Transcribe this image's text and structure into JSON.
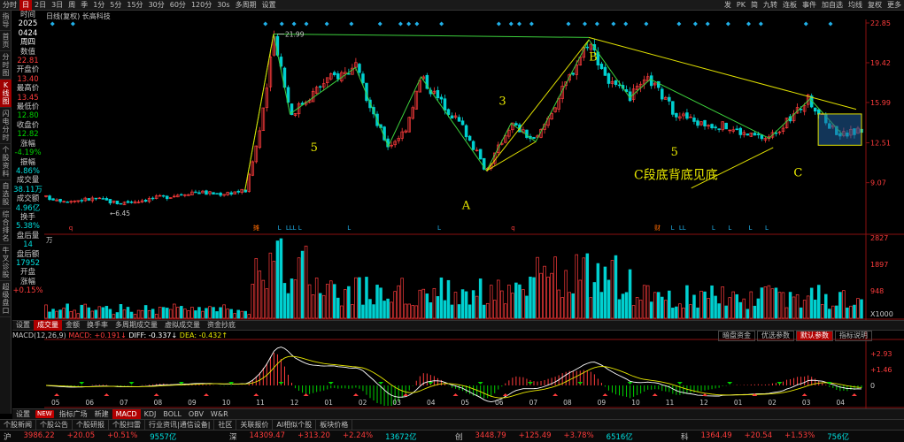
{
  "topbar": {
    "items": [
      "分时",
      "日",
      "2日",
      "3日",
      "周",
      "季",
      "1分",
      "5分",
      "15分",
      "30分",
      "60分",
      "120分",
      "30s",
      "多周期",
      "设置"
    ],
    "active_index": 1,
    "right_items": [
      "发",
      "PK",
      "简",
      "九转",
      "连板",
      "事件",
      "加自选",
      "均线",
      "复权",
      "更多"
    ]
  },
  "leftnav": [
    "指导",
    "首页",
    "分时图",
    "K线图",
    "闪电分时",
    "个股资料",
    "自选股",
    "综合排名",
    "牛叉诊股",
    "超级盘口"
  ],
  "leftnav_active": 3,
  "chart_title": "日线(复权) 长高科技",
  "info": [
    {
      "label": "时间",
      "value": "2025",
      "cls": "wht"
    },
    {
      "label": "",
      "value": "0424",
      "cls": "wht"
    },
    {
      "label": "",
      "value": "周四",
      "cls": "wht"
    },
    {
      "label": "数值",
      "value": "22.81",
      "cls": "red"
    },
    {
      "label": "开盘价",
      "value": "13.40",
      "cls": "red"
    },
    {
      "label": "最高价",
      "value": "13.45",
      "cls": "red"
    },
    {
      "label": "最低价",
      "value": "12.80",
      "cls": "grn"
    },
    {
      "label": "收盘价",
      "value": "12.82",
      "cls": "grn"
    },
    {
      "label": "涨幅",
      "value": "-4.19%",
      "cls": "grn"
    },
    {
      "label": "振幅",
      "value": "4.86%",
      "cls": "cyn"
    },
    {
      "label": "成交量",
      "value": "38.11万",
      "cls": "cyn"
    },
    {
      "label": "成交额",
      "value": "4.96亿",
      "cls": "cyn"
    },
    {
      "label": "换手",
      "value": "5.38%",
      "cls": "cyn"
    },
    {
      "label": "盘后量",
      "value": "14",
      "cls": "cyn"
    },
    {
      "label": "盘后额",
      "value": "17952",
      "cls": "cyn"
    },
    {
      "label": "开盘",
      "value": "",
      "cls": "cyn"
    },
    {
      "label": "涨幅",
      "value": "+0.15%",
      "cls": "red"
    }
  ],
  "price_axis": [
    "22.85",
    "19.42",
    "15.99",
    "12.51",
    "9.07"
  ],
  "price_marks": {
    "high": "21.99",
    "low": "6.45"
  },
  "annotations": {
    "wave5_left": "5",
    "wave3": "3",
    "labelA": "A",
    "labelB": "B",
    "wave5_right": "5",
    "labelC": "C",
    "c_text": "C段底背底见底"
  },
  "event_markers": [
    "q",
    "摊",
    "L",
    "LLL",
    "L",
    "L",
    "L",
    "q",
    "财",
    "L",
    "LL",
    "L",
    "L",
    "L",
    "L"
  ],
  "volume": {
    "unit_label": "万",
    "axis": [
      "2827",
      "1897",
      "948",
      "X1000"
    ]
  },
  "vol_tabs": [
    "设置",
    "成交量",
    "金额",
    "换手率",
    "多周期成交量",
    "虚拟成交量",
    "资金抄底"
  ],
  "vol_tab_active": 1,
  "macd": {
    "header": "MACD(12,26,9)",
    "macd": "MACD: +0.191↓",
    "diff": "DIFF: -0.337↓",
    "dea": "DEA: -0.432↑",
    "axis": [
      "+2.93",
      "+1.46",
      "0"
    ]
  },
  "macd_tabs": [
    "暗盘资金",
    "优选参数",
    "默认参数",
    "指标说明"
  ],
  "macd_tab_active": 2,
  "months": [
    "05",
    "06",
    "07",
    "08",
    "09",
    "10",
    "11",
    "12",
    "01",
    "02",
    "03",
    "04",
    "05",
    "06",
    "07",
    "08",
    "09",
    "10",
    "11",
    "12",
    "01",
    "02",
    "03",
    "04"
  ],
  "bottom_tabs": [
    "设置",
    "NEW",
    "指标广场",
    "新建",
    "MACD",
    "KDJ",
    "BOLL",
    "OBV",
    "W&R"
  ],
  "bottom_tab_active": 4,
  "news": [
    "个股新闻",
    "个股公告",
    "个股研报",
    "个股扫雷",
    "行业资讯|通信设备|",
    "社区",
    "关联报价",
    "AI相似个股",
    "板块价格"
  ],
  "status": {
    "sh": {
      "name": "沪",
      "index": "3986.22",
      "chg": "+20.05",
      "pct": "+0.51%",
      "amt": "9557亿"
    },
    "sz": {
      "name": "深",
      "index": "14309.47",
      "chg": "+313.20",
      "pct": "+2.24%",
      "amt": "13672亿"
    },
    "cy": {
      "name": "创",
      "index": "3448.79",
      "chg": "+125.49",
      "pct": "+3.78%",
      "amt": "6516亿"
    },
    "kc": {
      "name": "科",
      "index": "1364.49",
      "chg": "+20.54",
      "pct": "+1.53%",
      "amt": "756亿"
    }
  },
  "colors": {
    "up": "#ff3c3c",
    "down": "#00d0d0",
    "wave": "#3cd03c",
    "trend": "#e0e000",
    "box_fill": "#2060a0"
  }
}
